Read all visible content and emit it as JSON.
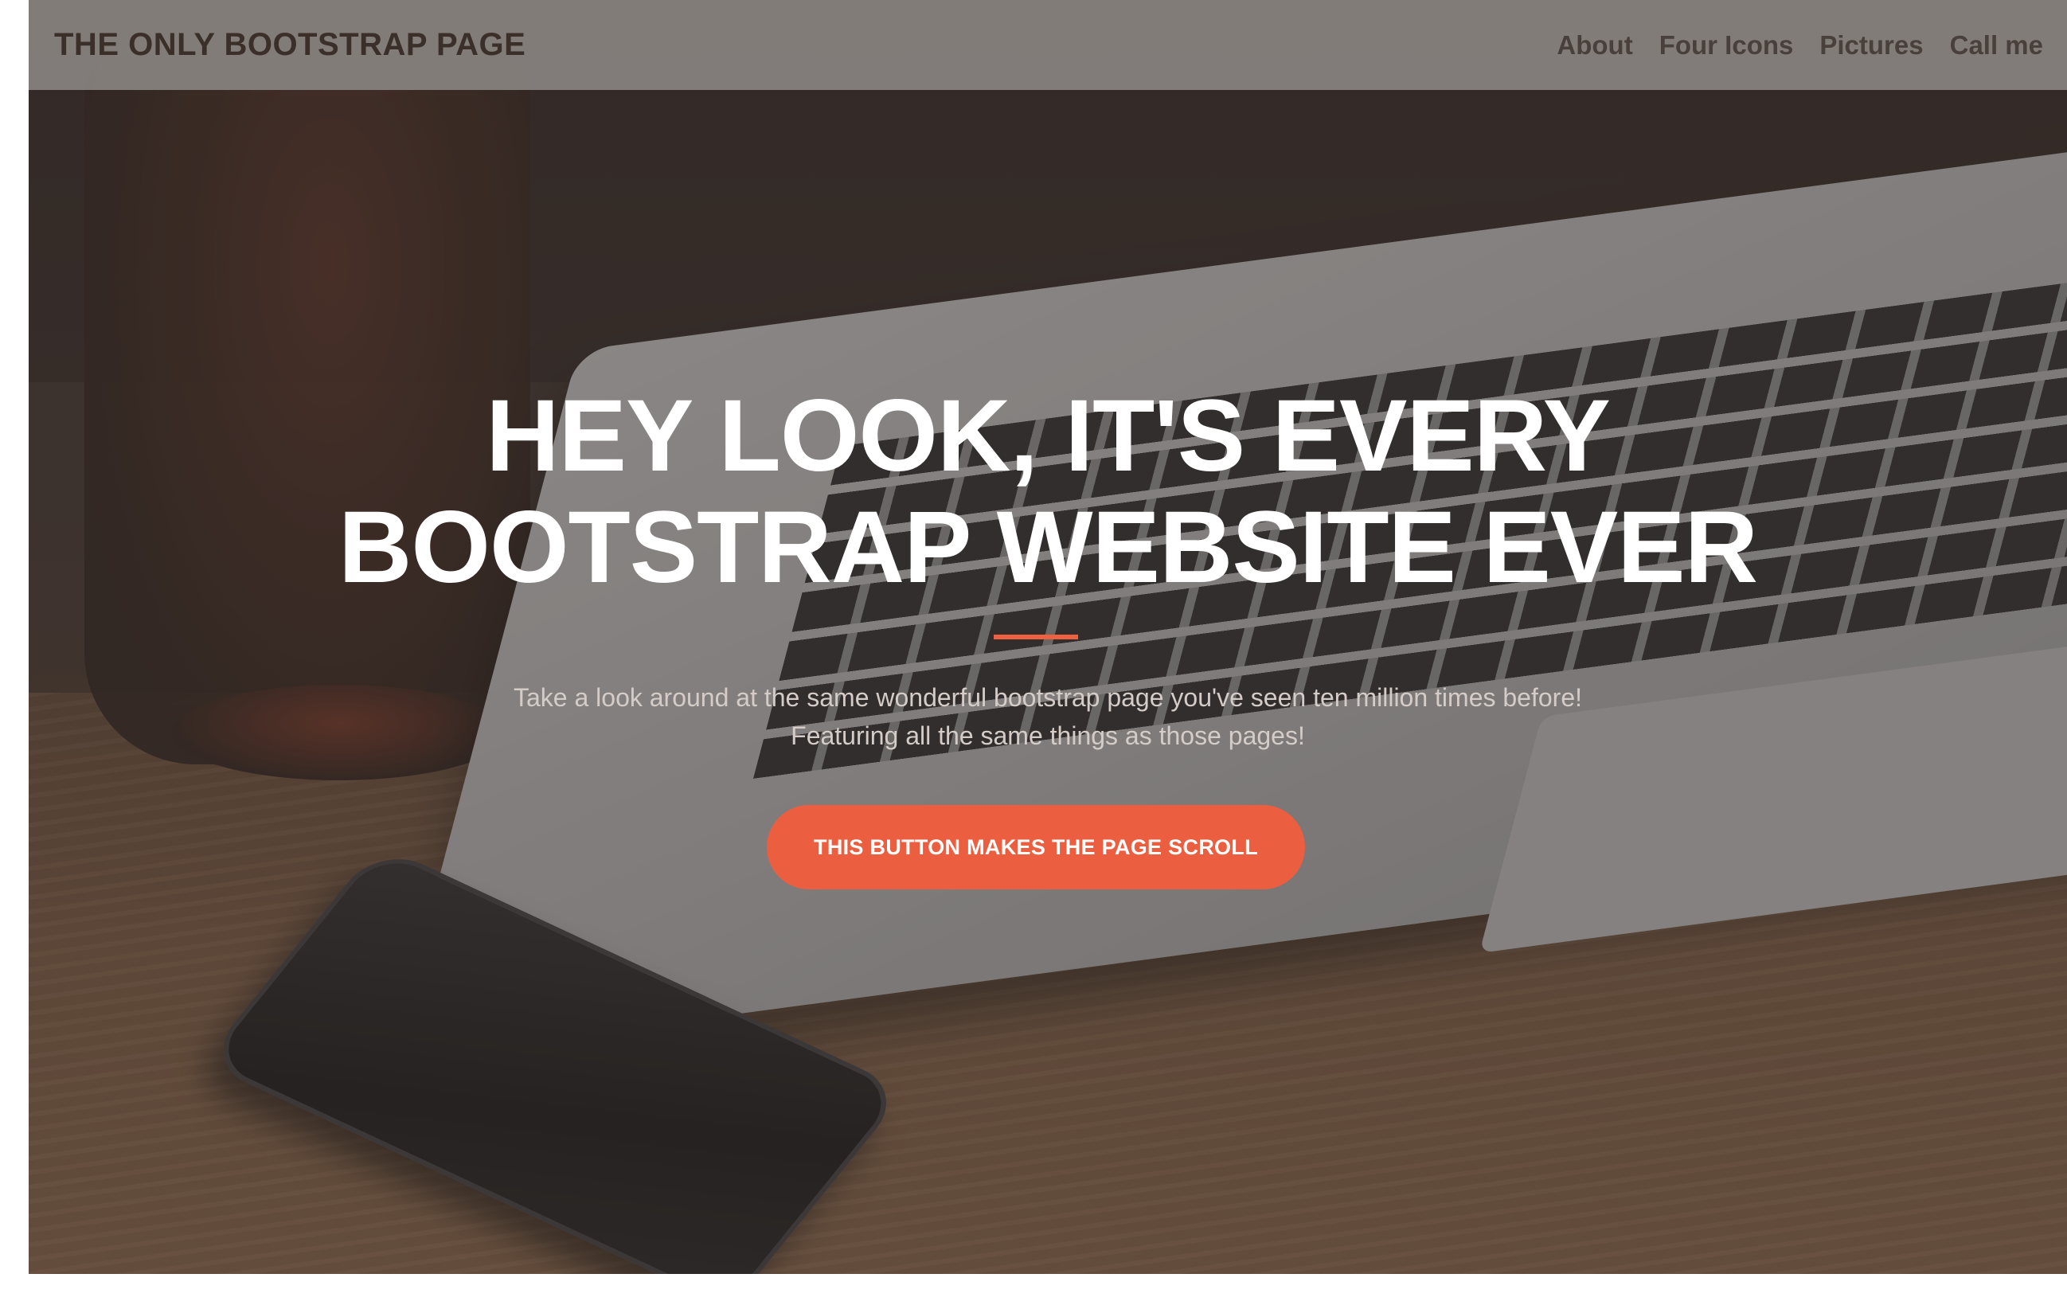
{
  "navbar": {
    "brand": "THE ONLY BOOTSTRAP PAGE",
    "links": [
      {
        "label": "About"
      },
      {
        "label": "Four Icons"
      },
      {
        "label": "Pictures"
      },
      {
        "label": "Call me"
      }
    ]
  },
  "hero": {
    "title_line1": "HEY LOOK, IT'S EVERY",
    "title_line2": "BOOTSTRAP WEBSITE EVER",
    "text_line1": "Take a look around at the same wonderful bootstrap page you've seen ten million times before!",
    "text_line2": "Featuring all the same things as those pages!",
    "button_label": "THIS BUTTON MAKES THE PAGE SCROLL"
  },
  "colors": {
    "accent": "#F05F40",
    "navbar_bg": "#8C8884",
    "title_text": "#FFFFFF"
  }
}
